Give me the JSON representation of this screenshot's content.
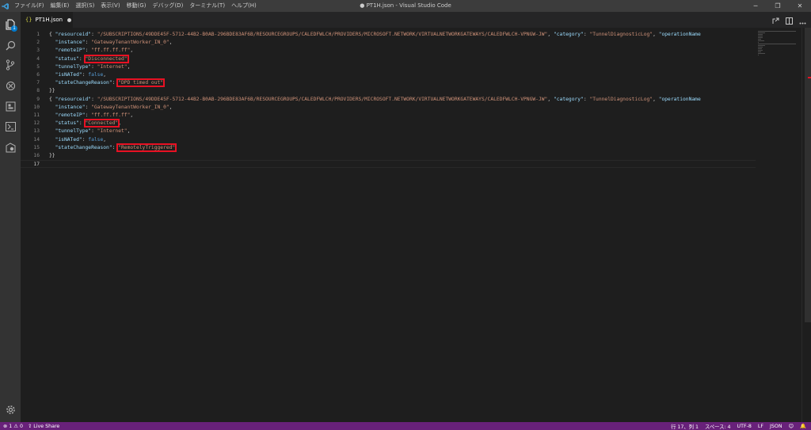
{
  "titlebar": {
    "menu": [
      "ファイル(F)",
      "編集(E)",
      "選択(S)",
      "表示(V)",
      "移動(G)",
      "デバッグ(D)",
      "ターミナル(T)",
      "ヘルプ(H)"
    ],
    "window_title": "● PT1H.json - Visual Studio Code",
    "minimize": "─",
    "restore": "❐",
    "close": "✕"
  },
  "activity_bar": {
    "icons": [
      "explorer-icon",
      "search-icon",
      "source-control-icon",
      "debug-icon",
      "extensions-icon",
      "terminal-icon",
      "remote-icon",
      "gear-icon"
    ],
    "explorer_badge": "1"
  },
  "tab": {
    "icon": "{}",
    "label": "PT1H.json",
    "modified": true
  },
  "editor": {
    "current_line": "17",
    "lines": [
      {
        "n": "1",
        "parts": [
          {
            "t": "{ ",
            "c": "p"
          },
          {
            "t": "\"resourceid\"",
            "c": "k"
          },
          {
            "t": ": ",
            "c": "p"
          },
          {
            "t": "\"/SUBSCRIPTIONS/49DDE45F-5712-44B2-B0AB-296BDE83AF6B/RESOURCEGROUPS/CALEDFWLCH/PROVIDERS/MICROSOFT.NETWORK/VIRTUALNETWORKGATEWAYS/CALEDFWLCH-VPNGW-JW\"",
            "c": "s"
          },
          {
            "t": ", ",
            "c": "p"
          },
          {
            "t": "\"category\"",
            "c": "k"
          },
          {
            "t": ": ",
            "c": "p"
          },
          {
            "t": "\"TunnelDiagnosticLog\"",
            "c": "s"
          },
          {
            "t": ", ",
            "c": "p"
          },
          {
            "t": "\"operationName",
            "c": "k"
          }
        ]
      },
      {
        "n": "2",
        "parts": [
          {
            "t": "  \"instance\"",
            "c": "k"
          },
          {
            "t": ": ",
            "c": "p"
          },
          {
            "t": "\"GatewayTenantWorker_IN_0\"",
            "c": "s"
          },
          {
            "t": ",",
            "c": "p"
          }
        ]
      },
      {
        "n": "3",
        "parts": [
          {
            "t": "  \"remoteIP\"",
            "c": "k"
          },
          {
            "t": ": ",
            "c": "p"
          },
          {
            "t": "\"ff.ff.ff.ff\"",
            "c": "s"
          },
          {
            "t": ",",
            "c": "p"
          }
        ]
      },
      {
        "n": "4",
        "parts": [
          {
            "t": "  \"status\"",
            "c": "k"
          },
          {
            "t": ": ",
            "c": "p"
          },
          {
            "t": "\"Disconnected\"",
            "c": "s",
            "hl": true
          },
          {
            "t": ",",
            "c": "p"
          }
        ]
      },
      {
        "n": "5",
        "parts": [
          {
            "t": "  \"tunnelType\"",
            "c": "k"
          },
          {
            "t": ": ",
            "c": "p"
          },
          {
            "t": "\"Internet\"",
            "c": "s"
          },
          {
            "t": ",",
            "c": "p"
          }
        ]
      },
      {
        "n": "6",
        "parts": [
          {
            "t": "  \"isNATed\"",
            "c": "k"
          },
          {
            "t": ": ",
            "c": "p"
          },
          {
            "t": "false",
            "c": "b"
          },
          {
            "t": ",",
            "c": "p"
          }
        ]
      },
      {
        "n": "7",
        "parts": [
          {
            "t": "  \"stateChangeReason\"",
            "c": "k"
          },
          {
            "t": ": ",
            "c": "p"
          },
          {
            "t": "\"DPD timed out\"",
            "c": "s",
            "hl": true
          }
        ]
      },
      {
        "n": "8",
        "parts": [
          {
            "t": "}}",
            "c": "p"
          }
        ]
      },
      {
        "n": "9",
        "parts": [
          {
            "t": "{ ",
            "c": "p"
          },
          {
            "t": "\"resourceid\"",
            "c": "k"
          },
          {
            "t": ": ",
            "c": "p"
          },
          {
            "t": "\"/SUBSCRIPTIONS/49DDE45F-5712-44B2-B0AB-296BDE83AF6B/RESOURCEGROUPS/CALEDFWLCH/PROVIDERS/MICROSOFT.NETWORK/VIRTUALNETWORKGATEWAYS/CALEDFWLCH-VPNGW-JW\"",
            "c": "s"
          },
          {
            "t": ", ",
            "c": "p"
          },
          {
            "t": "\"category\"",
            "c": "k"
          },
          {
            "t": ": ",
            "c": "p"
          },
          {
            "t": "\"TunnelDiagnosticLog\"",
            "c": "s"
          },
          {
            "t": ", ",
            "c": "p"
          },
          {
            "t": "\"operationName",
            "c": "k"
          }
        ]
      },
      {
        "n": "10",
        "parts": [
          {
            "t": "  \"instance\"",
            "c": "k"
          },
          {
            "t": ": ",
            "c": "p"
          },
          {
            "t": "\"GatewayTenantWorker_IN_0\"",
            "c": "s"
          },
          {
            "t": ",",
            "c": "p"
          }
        ]
      },
      {
        "n": "11",
        "parts": [
          {
            "t": "  \"remoteIP\"",
            "c": "k"
          },
          {
            "t": ": ",
            "c": "p"
          },
          {
            "t": "\"ff.ff.ff.ff\"",
            "c": "s"
          },
          {
            "t": ",",
            "c": "p"
          }
        ]
      },
      {
        "n": "12",
        "parts": [
          {
            "t": "  \"status\"",
            "c": "k"
          },
          {
            "t": ": ",
            "c": "p"
          },
          {
            "t": "\"Connected\"",
            "c": "s",
            "hl": true
          },
          {
            "t": ",",
            "c": "p"
          }
        ]
      },
      {
        "n": "13",
        "parts": [
          {
            "t": "  \"tunnelType\"",
            "c": "k"
          },
          {
            "t": ": ",
            "c": "p"
          },
          {
            "t": "\"Internet\"",
            "c": "s"
          },
          {
            "t": ",",
            "c": "p"
          }
        ]
      },
      {
        "n": "14",
        "parts": [
          {
            "t": "  \"isNATed\"",
            "c": "k"
          },
          {
            "t": ": ",
            "c": "p"
          },
          {
            "t": "false",
            "c": "b"
          },
          {
            "t": ",",
            "c": "p"
          }
        ]
      },
      {
        "n": "15",
        "parts": [
          {
            "t": "  \"stateChangeReason\"",
            "c": "k"
          },
          {
            "t": ": ",
            "c": "p"
          },
          {
            "t": "\"RemotelyTriggered\"",
            "c": "s",
            "hl": true
          }
        ]
      },
      {
        "n": "16",
        "parts": [
          {
            "t": "}}",
            "c": "p"
          }
        ]
      },
      {
        "n": "17",
        "parts": []
      }
    ]
  },
  "statusbar": {
    "errors": "1",
    "warnings": "0",
    "live_share": "Live Share",
    "position": "行 17、列 1",
    "spaces": "スペース: 4",
    "encoding": "UTF-8",
    "eol": "LF",
    "language": "JSON"
  },
  "colors": {
    "accent": "#007acc",
    "statusbar": "#68217a",
    "highlight_box": "#e81123",
    "string": "#ce9178",
    "key": "#9cdcfe"
  }
}
